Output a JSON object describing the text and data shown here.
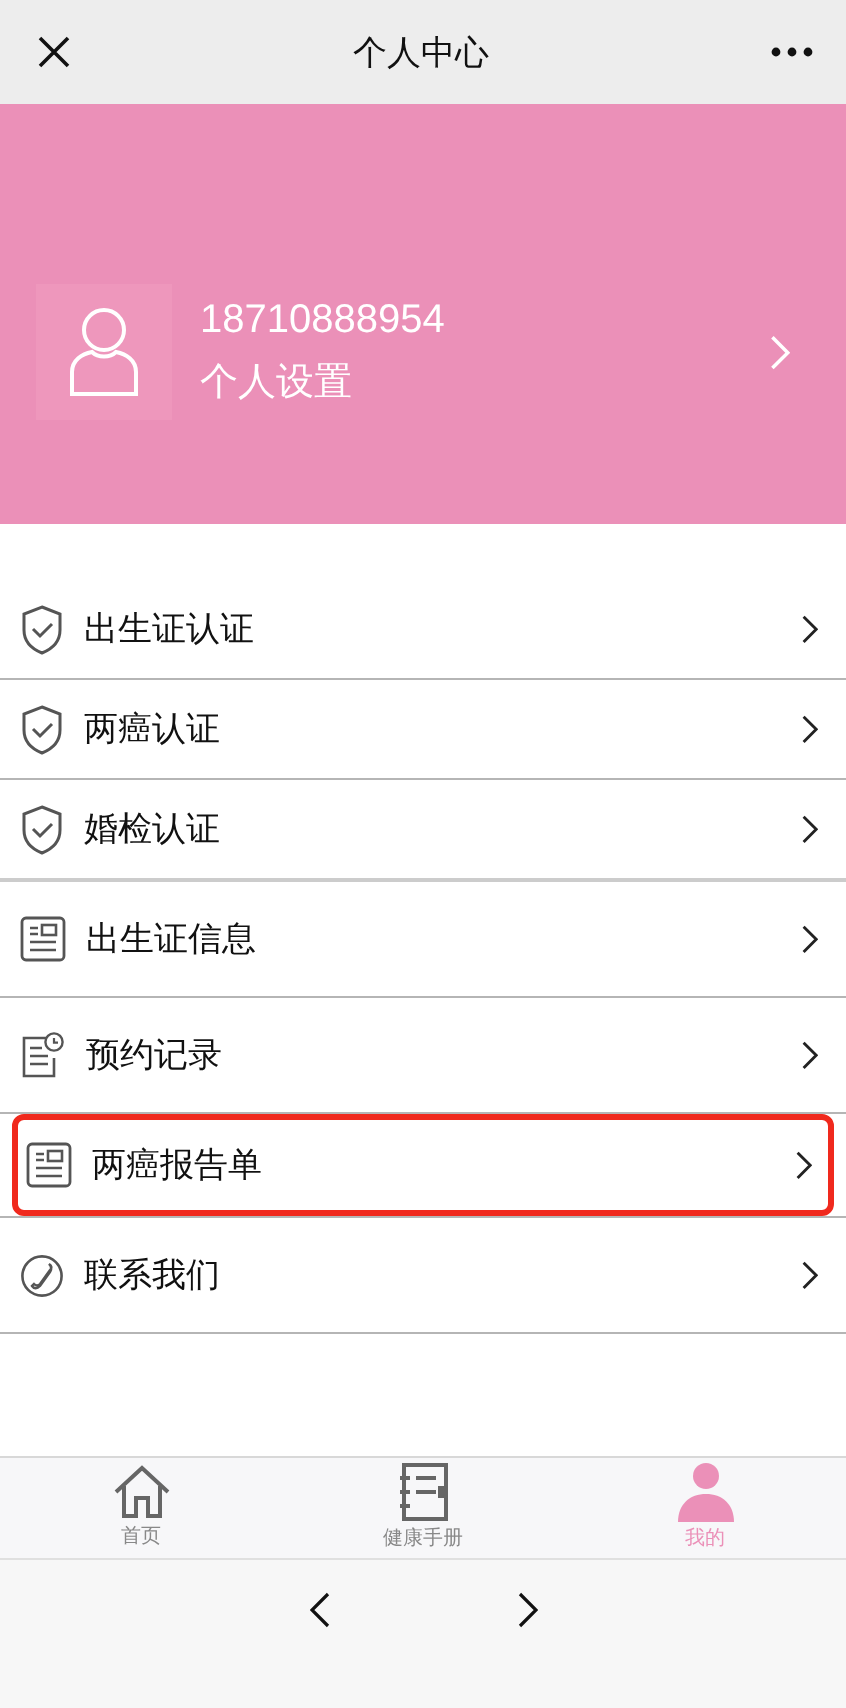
{
  "header": {
    "title": "个人中心"
  },
  "profile": {
    "phone": "18710888954",
    "subtitle": "个人设置"
  },
  "menu": [
    {
      "kind": "shield",
      "label": "出生证认证",
      "highlighted": false
    },
    {
      "kind": "shield",
      "label": "两癌认证",
      "highlighted": false
    },
    {
      "kind": "shield",
      "label": "婚检认证",
      "highlighted": false
    },
    {
      "kind": "document",
      "label": "出生证信息",
      "highlighted": false
    },
    {
      "kind": "schedule",
      "label": "预约记录",
      "highlighted": false
    },
    {
      "kind": "document",
      "label": "两癌报告单",
      "highlighted": true
    },
    {
      "kind": "phone",
      "label": "联系我们",
      "highlighted": false
    }
  ],
  "tabs": [
    {
      "kind": "home",
      "label": "首页",
      "selected": false
    },
    {
      "kind": "notebook",
      "label": "健康手册",
      "selected": false
    },
    {
      "kind": "person",
      "label": "我的",
      "selected": true
    }
  ]
}
